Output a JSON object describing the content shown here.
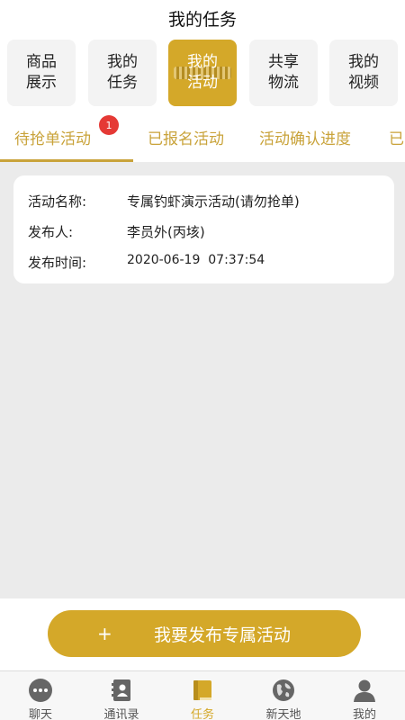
{
  "header": {
    "title": "我的任务"
  },
  "categories": [
    {
      "label": "商品\n展示",
      "active": false
    },
    {
      "label": "我的\n任务",
      "active": false
    },
    {
      "label": "我的\n活动",
      "active": true
    },
    {
      "label": "共享\n物流",
      "active": false
    },
    {
      "label": "我的\n视频",
      "active": false
    }
  ],
  "tabs": [
    {
      "label": "待抢单活动",
      "active": true,
      "badge": "1"
    },
    {
      "label": "已报名活动",
      "active": false
    },
    {
      "label": "活动确认进度",
      "active": false
    },
    {
      "label": "已",
      "active": false
    }
  ],
  "card": {
    "name_key": "活动名称:",
    "name_value": "专属钓虾演示活动(请勿抢单)",
    "publisher_key": "发布人:",
    "publisher_value": "李员外(丙垓)",
    "time_key": "发布时间:",
    "time_value": "2020-06-19  07:37:54"
  },
  "post_button": {
    "plus": "+",
    "label": "我要发布专属活动"
  },
  "tabbar": [
    {
      "label": "聊天",
      "icon": "chat-bubble-icon",
      "active": false
    },
    {
      "label": "通讯录",
      "icon": "contacts-book-icon",
      "active": false
    },
    {
      "label": "任务",
      "icon": "task-book-icon",
      "active": true
    },
    {
      "label": "新天地",
      "icon": "globe-icon",
      "active": false
    },
    {
      "label": "我的",
      "icon": "person-icon",
      "active": false
    }
  ],
  "colors": {
    "accent": "#d4a829",
    "tab_text": "#c9a33a",
    "badge": "#e53935",
    "background": "#ebebeb"
  }
}
